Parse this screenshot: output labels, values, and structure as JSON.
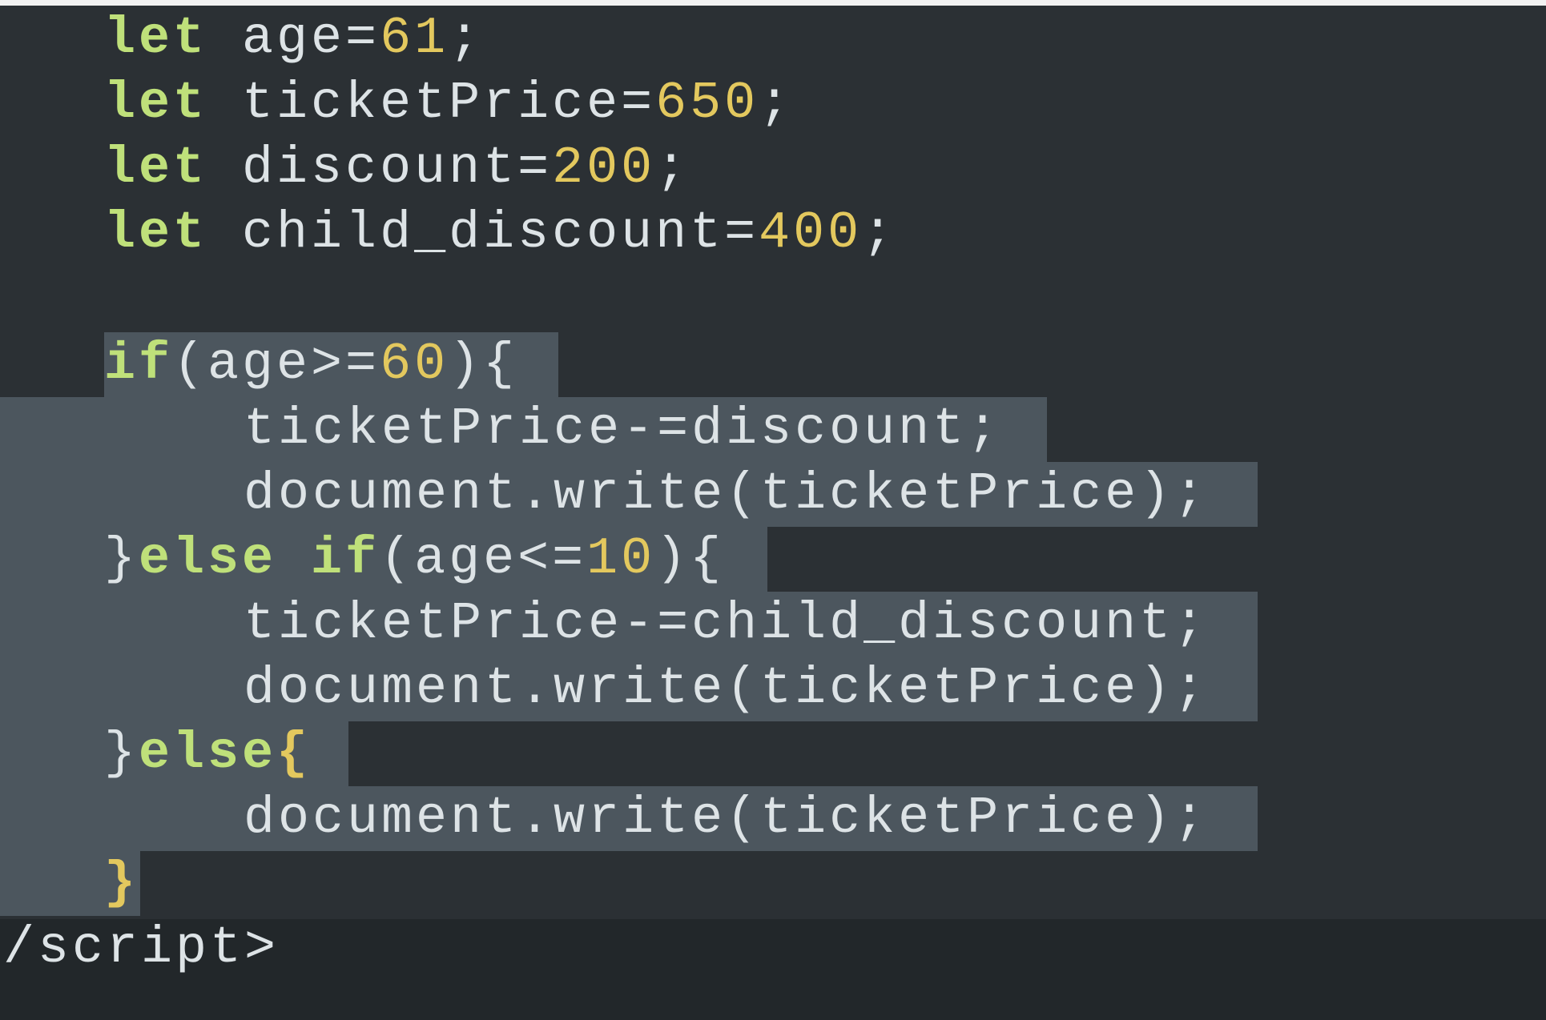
{
  "theme": {
    "background": "#2b3034",
    "selection": "#4c565e",
    "keyword_color": "#bfe07a",
    "number_color": "#e3c85e",
    "text_color": "#dde3e6"
  },
  "code": {
    "lines": [
      {
        "indent": "   ",
        "kw": "let",
        "rest": " age=",
        "num": "61",
        "tail": ";"
      },
      {
        "indent": "   ",
        "kw": "let",
        "rest": " ticketPrice=",
        "num": "650",
        "tail": ";"
      },
      {
        "indent": "   ",
        "kw": "let",
        "rest": " discount=",
        "num": "200",
        "tail": ";"
      },
      {
        "indent": "   ",
        "kw": "let",
        "rest": " child_discount=",
        "num": "400",
        "tail": ";"
      },
      {
        "indent": "",
        "kw": "",
        "rest": "",
        "num": "",
        "tail": ""
      },
      {
        "indent": "   ",
        "kw": "if",
        "rest": "(age>=",
        "num": "60",
        "tail": "){"
      },
      {
        "indent": "       ",
        "kw": "",
        "rest": "ticketPrice-=discount;",
        "num": "",
        "tail": ""
      },
      {
        "indent": "       ",
        "kw": "",
        "rest": "document.write(ticketPrice);",
        "num": "",
        "tail": ""
      },
      {
        "indent": "   ",
        "pre": "}",
        "kw": "else if",
        "rest": "(age<=",
        "num": "10",
        "tail": "){"
      },
      {
        "indent": "       ",
        "kw": "",
        "rest": "ticketPrice-=child_discount;",
        "num": "",
        "tail": ""
      },
      {
        "indent": "       ",
        "kw": "",
        "rest": "document.write(ticketPrice);",
        "num": "",
        "tail": ""
      },
      {
        "indent": "   ",
        "pre": "}",
        "kw": "else",
        "rest": "",
        "num": "",
        "tail": "",
        "brace": "{"
      },
      {
        "indent": "       ",
        "kw": "",
        "rest": "document.write(ticketPrice);",
        "num": "",
        "tail": ""
      },
      {
        "indent": "   ",
        "kw": "",
        "rest": "",
        "num": "",
        "tail": "",
        "brace": "}"
      },
      {
        "indent": "",
        "kw": "",
        "rest": "/script>",
        "num": "",
        "tail": ""
      }
    ]
  }
}
